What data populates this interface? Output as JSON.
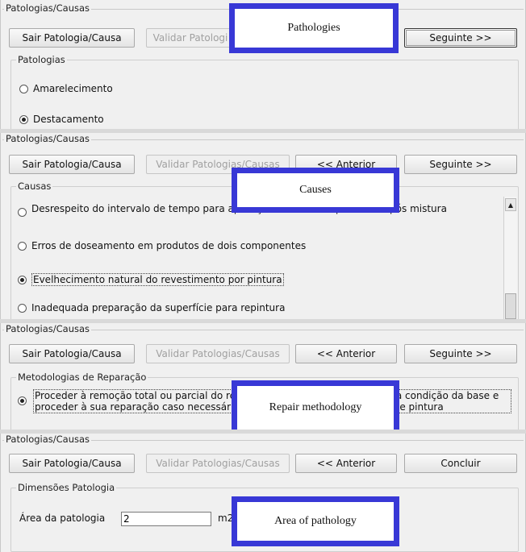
{
  "panel1": {
    "title": "Patologias/Causas",
    "buttons": {
      "exit": "Sair Patologia/Causa",
      "validate": "Validar Patologi",
      "next": "Seguinte >>"
    },
    "group_label": "Patologias",
    "options": [
      "Amarelecimento",
      "Destacamento"
    ],
    "overlay": "Pathologies"
  },
  "panel2": {
    "title": "Patologias/Causas",
    "buttons": {
      "exit": "Sair Patologia/Causa",
      "validate": "Validar Patologias/Causas",
      "prev": "<< Anterior",
      "next": "Seguinte >>"
    },
    "group_label": "Causas",
    "options": [
      "Desrespeito do intervalo de tempo para aplicação de dois componentes após mistura",
      "Erros de doseamento em produtos de dois componentes",
      "Evelhecimento natural do revestimento por pintura",
      "Inadequada preparação da superfície para repintura"
    ],
    "overlay": "Causes"
  },
  "panel3": {
    "title": "Patologias/Causas",
    "buttons": {
      "exit": "Sair Patologia/Causa",
      "validate": "Validar Patologias/Causas",
      "prev": "<< Anterior",
      "next": "Seguinte >>"
    },
    "group_label": "Metodologias de Reparação",
    "option": "Proceder à remoção total ou parcial do revestimento por pintura, verificar a condição da base e proceder à sua reparação caso necessário. Proceder à preparação da base e pintura",
    "overlay": "Repair methodology"
  },
  "panel4": {
    "title": "Patologias/Causas",
    "buttons": {
      "exit": "Sair Patologia/Causa",
      "validate": "Validar Patologias/Causas",
      "prev": "<< Anterior",
      "finish": "Concluir"
    },
    "group_label": "Dimensões Patologia",
    "area_label": "Área da patologia",
    "area_value": "2",
    "unit": "m2",
    "overlay": "Area of pathology"
  }
}
